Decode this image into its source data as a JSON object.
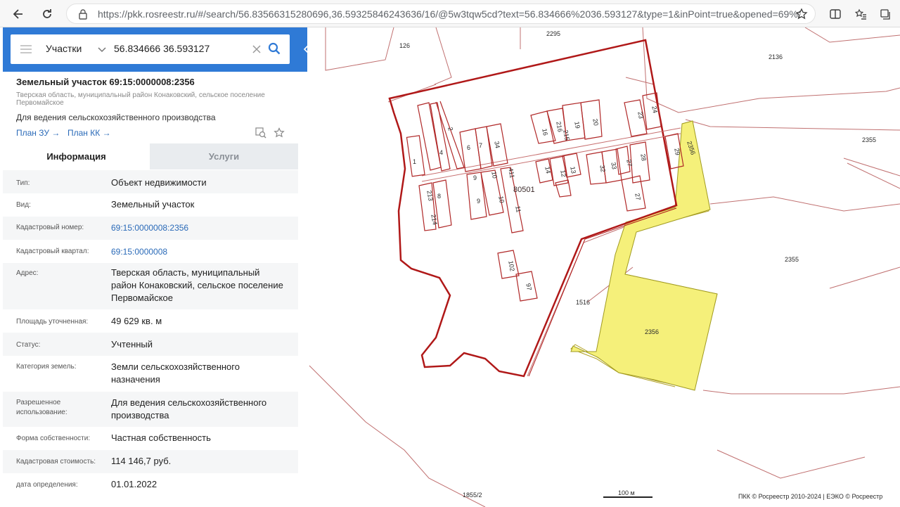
{
  "browser": {
    "url": "https://pkk.rosreestr.ru/#/search/56.83566315280696,36.59325846243636/16/@5w3tqw5cd?text=56.834666%2036.593127&type=1&inPoint=true&opened=69%3A15%..."
  },
  "search": {
    "category": "Участки",
    "query": "56.834666 36.593127"
  },
  "parcel": {
    "title": "Земельный участок 69:15:0000008:2356",
    "address_short": "Тверская область, муниципальный район Конаковский, сельское поселение Первомайское",
    "purpose": "Для ведения сельскохозяйственного производства",
    "plan_zu": "План ЗУ",
    "plan_kk": "План КК"
  },
  "tabs": {
    "info": "Информация",
    "services": "Услуги"
  },
  "rows": [
    {
      "label": "Тип:",
      "value": "Объект недвижимости"
    },
    {
      "label": "Вид:",
      "value": "Земельный участок"
    },
    {
      "label": "Кадастровый номер:",
      "value": "69:15:0000008:2356"
    },
    {
      "label": "Кадастровый квартал:",
      "value": "69:15:0000008"
    },
    {
      "label": "Адрес:",
      "value": "Тверская область, муниципальный район Конаковский, сельское поселение Первомайское"
    },
    {
      "label": "Площадь уточненная:",
      "value": "49 629 кв. м"
    },
    {
      "label": "Статус:",
      "value": "Учтенный"
    },
    {
      "label": "Категория земель:",
      "value": "Земли сельскохозяйственного назначения"
    },
    {
      "label": "Разрешенное использование:",
      "value": "Для ведения сельскохозяйственного производства"
    },
    {
      "label": "Форма собственности:",
      "value": "Частная собственность"
    },
    {
      "label": "Кадастровая стоимость:",
      "value": "114 146,7 руб."
    },
    {
      "label": "дата определения:",
      "value": "01.01.2022"
    }
  ],
  "map": {
    "labels": {
      "l2295": "2295",
      "l126": "126",
      "l2136": "2136",
      "l2355a": "2355",
      "l2355b": "2355",
      "l2356a": "2356",
      "l2356b": "2356",
      "l1516": "1516",
      "l80501": "80501",
      "l18552": "1855/2",
      "l102": "102",
      "l97": "97",
      "l23": "23",
      "l24": "24",
      "l29": "29",
      "l28": "28",
      "l27a": "27",
      "l27b": "27",
      "l33": "33",
      "l32": "32",
      "l13": "13",
      "l12": "12",
      "l14": "14",
      "l411": "411",
      "l10a": "10",
      "l10b": "10",
      "l11": "11",
      "l9a": "9",
      "l9b": "9",
      "l8": "8",
      "l213": "213",
      "l214": "214",
      "l1": "1",
      "l4": "4",
      "l2": "2",
      "l6": "6",
      "l7": "7",
      "l34": "34",
      "l16": "16",
      "l216": "216",
      "l215": "215",
      "l19": "19",
      "l20": "20"
    },
    "scale": "100 м",
    "copyright": "ПКК © Росреестр 2010-2024 | ЕЭКО © Росреестр"
  },
  "colors": {
    "accent": "#2f7ad6",
    "parcel_border": "#b01818",
    "selected_fill": "#f5f07a",
    "boundary": "#c06060"
  }
}
